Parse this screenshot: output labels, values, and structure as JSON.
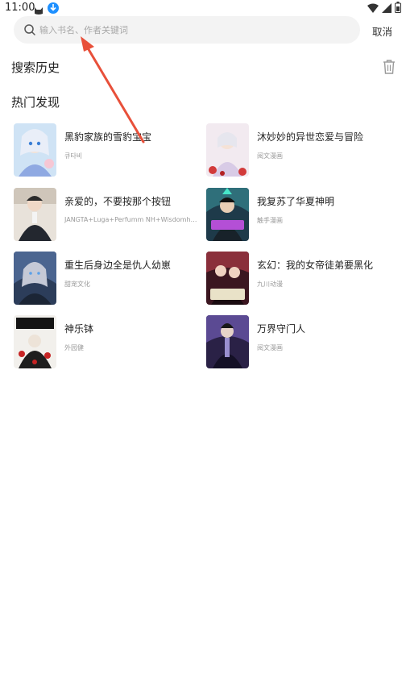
{
  "status_bar": {
    "time": "11:00",
    "icons": [
      "cat-icon",
      "download-icon",
      "wifi-icon",
      "signal-icon",
      "battery-icon"
    ]
  },
  "search": {
    "placeholder": "输入书名、作者关键词",
    "cancel_label": "取消"
  },
  "history": {
    "title": "搜索历史",
    "clear_icon": "trash-icon"
  },
  "discover": {
    "title": "热门发现",
    "items": [
      {
        "title": "黑豹家族的雪豹宝宝",
        "author": "큐타비"
      },
      {
        "title": "沐妙妙的异世恋爱与冒险",
        "author": "阅文漫画"
      },
      {
        "title": "亲爱的，不要按那个按钮",
        "author": "JANGTA+Luga+Perfumm NH+Wisdomhou..."
      },
      {
        "title": "我复苏了华夏神明",
        "author": "触手漫画"
      },
      {
        "title": "重生后身边全是仇人幼崽",
        "author": "甜宠文化"
      },
      {
        "title": "玄幻：我的女帝徒弟要黑化",
        "author": "九川动漫"
      },
      {
        "title": "神乐钵",
        "author": "外园健"
      },
      {
        "title": "万界守门人",
        "author": "阅文漫画"
      }
    ]
  },
  "colors": {
    "accent_arrow": "#e8503a",
    "search_bg": "#f3f3f3",
    "muted_text": "#9a9a9a"
  }
}
